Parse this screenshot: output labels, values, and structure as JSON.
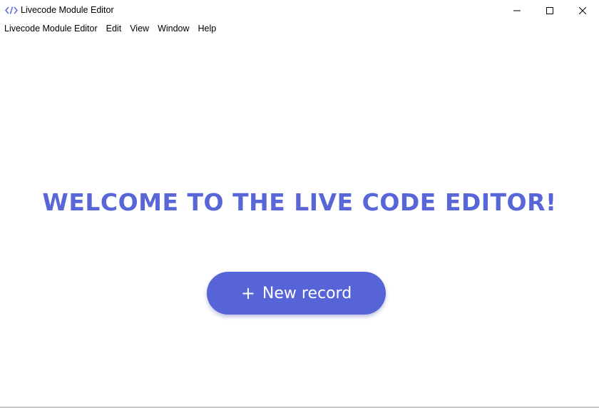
{
  "window": {
    "title": "Livecode Module Editor",
    "icon": "code-brackets-icon",
    "controls": {
      "minimize": "minimize-icon",
      "maximize": "maximize-icon",
      "close": "close-icon"
    }
  },
  "menubar": {
    "items": [
      {
        "label": "Livecode Module Editor"
      },
      {
        "label": "Edit"
      },
      {
        "label": "View"
      },
      {
        "label": "Window"
      },
      {
        "label": "Help"
      }
    ]
  },
  "main": {
    "welcome_text": "WELCOME TO THE LIVE CODE EDITOR!",
    "new_record_button": {
      "icon": "plus",
      "icon_glyph": "+",
      "label": "New record"
    }
  },
  "colors": {
    "accent": "#5664d8",
    "heading": "#5866d8",
    "button_text": "#ffffff"
  }
}
